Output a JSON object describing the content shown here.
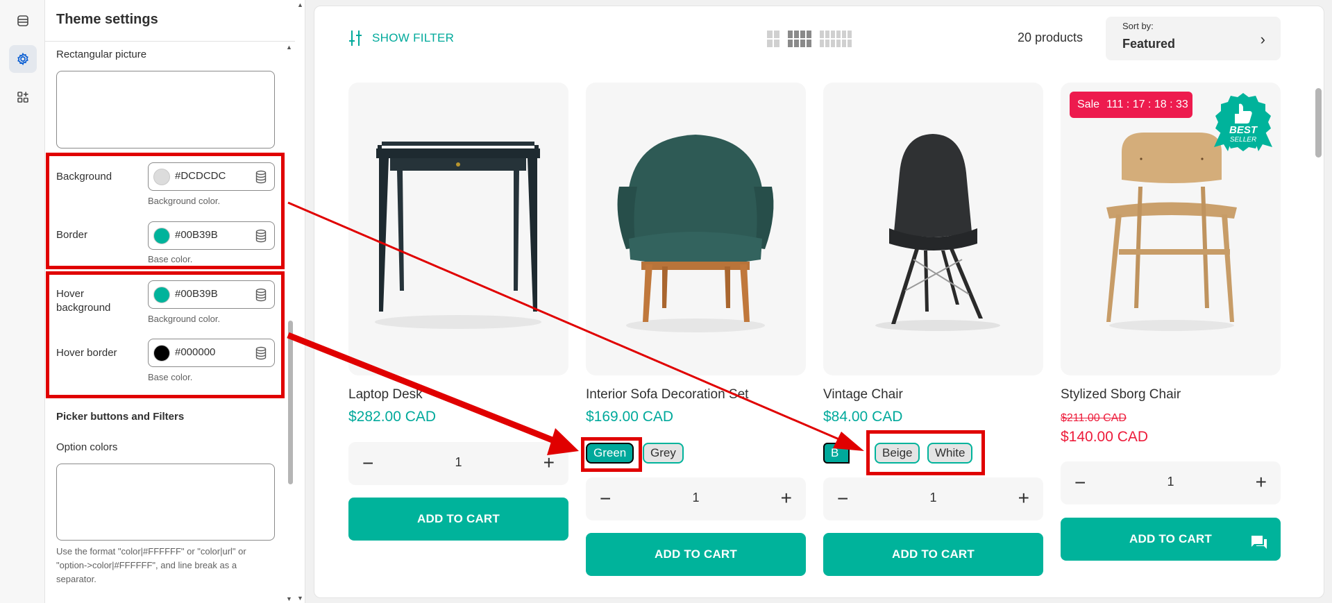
{
  "panel": {
    "title": "Theme settings",
    "rectangular_picture_label": "Rectangular picture",
    "background": {
      "label": "Background",
      "value": "#DCDCDC",
      "help": "Background color.",
      "swatch": "#DCDCDC"
    },
    "border": {
      "label": "Border",
      "value": "#00B39B",
      "help": "Base color.",
      "swatch": "#00B39B"
    },
    "hover_background": {
      "label": "Hover background",
      "value": "#00B39B",
      "help": "Background color.",
      "swatch": "#00B39B"
    },
    "hover_border": {
      "label": "Hover border",
      "value": "#000000",
      "help": "Base color.",
      "swatch": "#000000"
    },
    "section_heading": "Picker buttons and Filters",
    "option_colors_label": "Option colors",
    "option_colors_help": "Use the format \"color|#FFFFFF\" or \"color|url\" or \"option->color|#FFFFFF\", and line break as a separator."
  },
  "toolbar": {
    "show_filter": "SHOW FILTER",
    "product_count": "20 products",
    "sort_label": "Sort by:",
    "sort_value": "Featured"
  },
  "products": [
    {
      "title": "Laptop Desk",
      "price": "$282.00 CAD",
      "qty": "1",
      "cta": "ADD TO CART"
    },
    {
      "title": "Interior Sofa Decoration Set",
      "price": "$169.00 CAD",
      "qty": "1",
      "cta": "ADD TO CART",
      "options": [
        "Green",
        "Grey"
      ]
    },
    {
      "title": "Vintage Chair",
      "price": "$84.00 CAD",
      "qty": "1",
      "cta": "ADD TO CART",
      "options": [
        "B",
        "Beige",
        "White"
      ]
    },
    {
      "title": "Stylized Sborg Chair",
      "old_price": "$211.00 CAD",
      "sale_price": "$140.00 CAD",
      "qty": "1",
      "cta": "ADD TO CART",
      "sale_badge": "Sale",
      "countdown": "111 : 17 : 18 : 33",
      "best_seller": [
        "BEST",
        "SELLER"
      ]
    }
  ],
  "colors": {
    "accent": "#00B39B",
    "sale": "#ED1B4E",
    "annotation_red": "#E00000"
  }
}
